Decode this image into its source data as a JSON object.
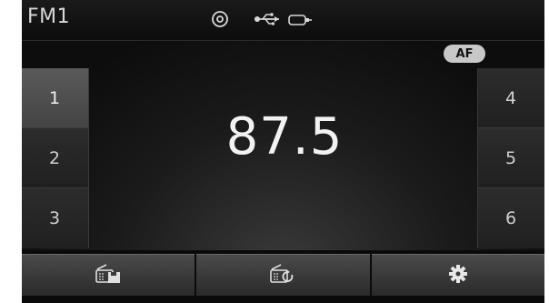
{
  "status": {
    "band": "FM1",
    "icons": [
      "disc-icon",
      "usb-icon",
      "aux-icon"
    ]
  },
  "af_badge": "AF",
  "frequency": "87.5",
  "presets_left": [
    {
      "label": "1",
      "active": true
    },
    {
      "label": "2",
      "active": false
    },
    {
      "label": "3",
      "active": false
    }
  ],
  "presets_right": [
    {
      "label": "4",
      "active": false
    },
    {
      "label": "5",
      "active": false
    },
    {
      "label": "6",
      "active": false
    }
  ],
  "bottom_buttons": [
    "radio-save-icon",
    "radio-scan-icon",
    "settings-gear-icon"
  ],
  "colors": {
    "background": "#0a0a0a",
    "text": "#f2f2f2",
    "active_preset": "#4e4e4e",
    "af_badge": "#c8c8c8"
  }
}
